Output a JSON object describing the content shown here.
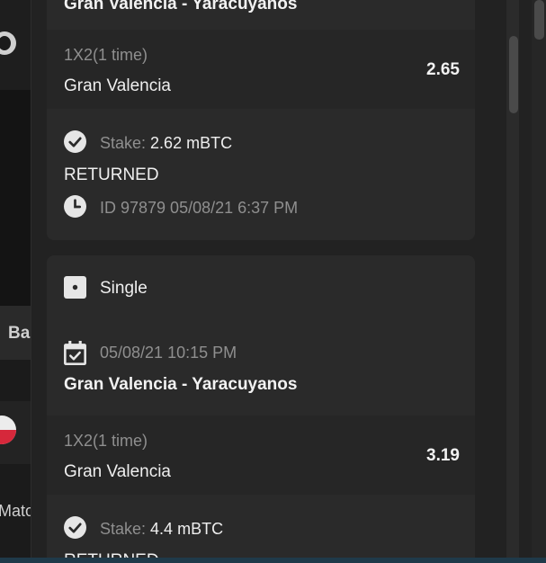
{
  "background": {
    "partial_label_1": "Ba",
    "partial_label_2": "Mato"
  },
  "bets": [
    {
      "match": "Gran Valencia - Yaracuyanos",
      "market": "1X2(1 time)",
      "selection": "Gran Valencia",
      "odds": "2.65",
      "stake_label": "Stake:",
      "stake_value": "2.62 mBTC",
      "status": "RETURNED",
      "id_line": "ID 97879 05/08/21 6:37 PM"
    },
    {
      "type": "Single",
      "date": "05/08/21 10:15 PM",
      "match": "Gran Valencia - Yaracuyanos",
      "market": "1X2(1 time)",
      "selection": "Gran Valencia",
      "odds": "3.19",
      "stake_label": "Stake:",
      "stake_value": "4.4 mBTC",
      "status": "RETURNED"
    }
  ]
}
